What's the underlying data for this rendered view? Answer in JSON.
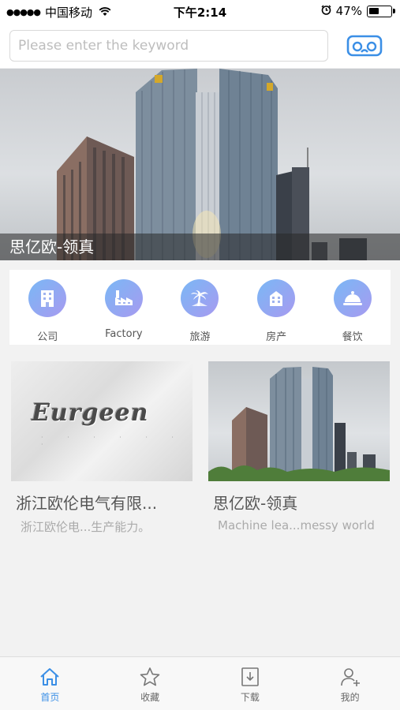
{
  "status_bar": {
    "carrier": "中国移动",
    "time": "下午2:14",
    "battery": "47%",
    "battery_level": 0.47
  },
  "search": {
    "placeholder": "Please enter the keyword",
    "value": ""
  },
  "banner": {
    "caption": "思亿欧-领真"
  },
  "categories": [
    {
      "label": "公司",
      "icon": "building-icon"
    },
    {
      "label": "Factory",
      "icon": "factory-icon"
    },
    {
      "label": "旅游",
      "icon": "palm-tree-icon"
    },
    {
      "label": "房产",
      "icon": "house-icon"
    },
    {
      "label": "餐饮",
      "icon": "dish-cloche-icon"
    }
  ],
  "cards": [
    {
      "title": "浙江欧伦电气有限...",
      "description": "浙江欧伦电...生产能力。",
      "image_text": "Eurgeen"
    },
    {
      "title": "思亿欧-领真",
      "description": "Machine lea...messy world"
    }
  ],
  "tabs": [
    {
      "label": "首页",
      "icon": "home-icon",
      "active": true
    },
    {
      "label": "收藏",
      "icon": "star-icon",
      "active": false
    },
    {
      "label": "下载",
      "icon": "download-icon",
      "active": false
    },
    {
      "label": "我的",
      "icon": "user-add-icon",
      "active": false
    }
  ],
  "colors": {
    "accent": "#3b8fe6",
    "category_gradient_start": "#7ab8f5",
    "category_gradient_end": "#a79af0"
  }
}
